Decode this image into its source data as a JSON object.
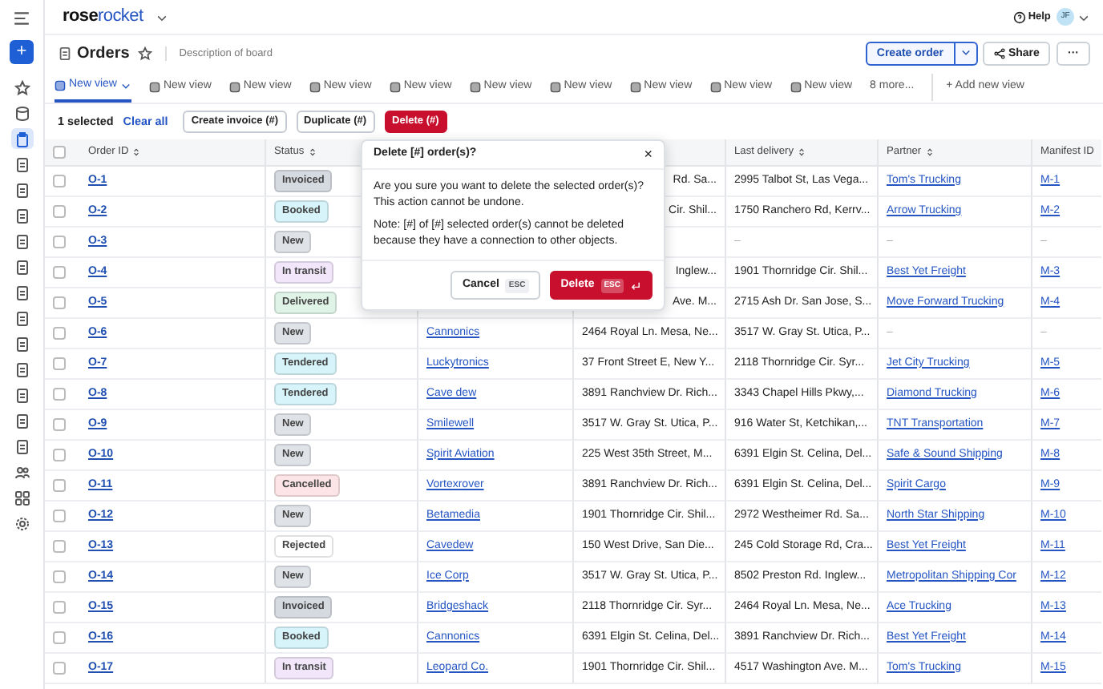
{
  "app": {
    "add": "+",
    "logo_start": "rose",
    "logo_end": "rocket",
    "help": "Help",
    "avatar": "JF"
  },
  "sidebar_items": [
    {
      "kind": "star",
      "selected": false
    },
    {
      "kind": "database",
      "selected": false
    },
    {
      "kind": "clipboard",
      "selected": true
    },
    {
      "kind": "doc",
      "selected": false
    },
    {
      "kind": "doc",
      "selected": false
    },
    {
      "kind": "doc",
      "selected": false
    },
    {
      "kind": "doc",
      "selected": false
    },
    {
      "kind": "doc",
      "selected": false
    },
    {
      "kind": "doc",
      "selected": false
    },
    {
      "kind": "doc",
      "selected": false
    },
    {
      "kind": "doc",
      "selected": false
    },
    {
      "kind": "doc",
      "selected": false
    },
    {
      "kind": "doc",
      "selected": false
    },
    {
      "kind": "doc",
      "selected": false
    },
    {
      "kind": "doc",
      "selected": false
    },
    {
      "kind": "people",
      "selected": false
    },
    {
      "kind": "grid",
      "selected": false
    },
    {
      "kind": "gear",
      "selected": false
    }
  ],
  "board": {
    "title": "Orders",
    "description": "Description of board",
    "create": "Create order",
    "share": "Share",
    "more": "···"
  },
  "tabs": [
    {
      "label": "New view",
      "selected": true
    },
    {
      "label": "New view",
      "selected": false
    },
    {
      "label": "New view",
      "selected": false
    },
    {
      "label": "New view",
      "selected": false
    },
    {
      "label": "New view",
      "selected": false
    },
    {
      "label": "New view",
      "selected": false
    },
    {
      "label": "New view",
      "selected": false
    },
    {
      "label": "New view",
      "selected": false
    },
    {
      "label": "New view",
      "selected": false
    },
    {
      "label": "New view",
      "selected": false
    }
  ],
  "tabs_more": "8 more...",
  "add_view": "+ Add new view",
  "actions": {
    "selected": "1 selected",
    "clear": "Clear all",
    "buttons": [
      {
        "label": "Create invoice (#)",
        "kind": "plain"
      },
      {
        "label": "Duplicate (#)",
        "kind": "plain"
      },
      {
        "label": "Delete (#)",
        "kind": "danger"
      }
    ]
  },
  "table": {
    "select_all_checked": false,
    "columns": [
      "Order ID",
      "Status",
      "",
      "",
      "Last delivery",
      "Partner",
      "Manifest ID"
    ],
    "rows": [
      {
        "checked": false,
        "id": "O-1",
        "status": {
          "label": "Invoiced",
          "color": "#d5d9e0"
        },
        "pickup": "Rd. Sa...",
        "delivery": "2995 Talbot St, Las Vega...",
        "partner": "Tom's Trucking",
        "manifest": "M-1"
      },
      {
        "checked": false,
        "id": "O-2",
        "status": {
          "label": "Booked",
          "color": "#d6f4fa"
        },
        "pickup": "Cir. Shil...",
        "delivery": "1750 Ranchero Rd, Kerrv...",
        "partner": "Arrow Trucking",
        "manifest": "M-2"
      },
      {
        "checked": false,
        "id": "O-3",
        "status": {
          "label": "New",
          "color": "#dfe2e7"
        },
        "delivery": "–",
        "partner": "–",
        "manifest": "–"
      },
      {
        "checked": false,
        "id": "O-4",
        "status": {
          "label": "In transit",
          "color": "#f1e6fa"
        },
        "pickup": "Inglew...",
        "delivery": "1901 Thornridge Cir. Shil...",
        "partner": "Best Yet Freight",
        "manifest": "M-3"
      },
      {
        "checked": false,
        "id": "O-5",
        "status": {
          "label": "Delivered",
          "color": "#dff3e6"
        },
        "pickup": "Ave. M...",
        "delivery": "2715 Ash Dr. San Jose, S...",
        "partner": "Move Forward Trucking",
        "manifest": "M-4"
      },
      {
        "checked": false,
        "id": "O-6",
        "status": {
          "label": "New",
          "color": "#dfe2e7"
        },
        "customer": "Cannonics",
        "pickup": "2464 Royal Ln. Mesa, Ne...",
        "delivery": "3517 W. Gray St. Utica, P...",
        "partner": "–",
        "manifest": "–"
      },
      {
        "checked": false,
        "id": "O-7",
        "status": {
          "label": "Tendered",
          "color": "#d6f4fa"
        },
        "customer": "Luckytronics",
        "pickup": "37 Front Street E, New Y...",
        "delivery": "2118 Thornridge Cir. Syr...",
        "partner": "Jet City Trucking",
        "manifest": "M-5"
      },
      {
        "checked": false,
        "id": "O-8",
        "status": {
          "label": "Tendered",
          "color": "#d6f4fa"
        },
        "customer": "Cave dew",
        "pickup": "3891 Ranchview Dr. Rich...",
        "delivery": "3343 Chapel Hills Pkwy,...",
        "partner": "Diamond Trucking",
        "manifest": "M-6"
      },
      {
        "checked": false,
        "id": "O-9",
        "status": {
          "label": "New",
          "color": "#dfe2e7"
        },
        "customer": "Smilewell",
        "pickup": "3517 W. Gray St. Utica, P...",
        "delivery": "916 Water St, Ketchikan,...",
        "partner": "TNT Transportation",
        "manifest": "M-7"
      },
      {
        "checked": false,
        "id": "O-10",
        "status": {
          "label": "New",
          "color": "#dfe2e7"
        },
        "customer": "Spirit Aviation",
        "pickup": "225 West 35th Street, M...",
        "delivery": "6391 Elgin St. Celina, Del...",
        "partner": "Safe & Sound Shipping",
        "manifest": "M-8"
      },
      {
        "checked": false,
        "id": "O-11",
        "status": {
          "label": "Cancelled",
          "color": "#fde4e6"
        },
        "customer": "Vortexrover",
        "pickup": "3891 Ranchview Dr. Rich...",
        "delivery": "6391 Elgin St. Celina, Del...",
        "partner": "Spirit Cargo",
        "manifest": "M-9"
      },
      {
        "checked": false,
        "id": "O-12",
        "status": {
          "label": "New",
          "color": "#dfe2e7"
        },
        "customer": "Betamedia",
        "pickup": "1901 Thornridge Cir. Shil...",
        "delivery": "2972 Westheimer Rd. Sa...",
        "partner": "North Star Shipping",
        "manifest": "M-10"
      },
      {
        "checked": false,
        "id": "O-13",
        "status": {
          "label": "Rejected",
          "color": "#ffffff"
        },
        "customer": "Cavedew",
        "pickup": "150 West Drive, San Die...",
        "delivery": "245 Cold Storage Rd, Cra...",
        "partner": "Best Yet Freight",
        "manifest": "M-11"
      },
      {
        "checked": false,
        "id": "O-14",
        "status": {
          "label": "New",
          "color": "#dfe2e7"
        },
        "customer": "Ice Corp",
        "pickup": "3517 W. Gray St. Utica, P...",
        "delivery": "8502 Preston Rd. Inglew...",
        "partner": "Metropolitan Shipping Cor",
        "manifest": "M-12"
      },
      {
        "checked": false,
        "id": "O-15",
        "status": {
          "label": "Invoiced",
          "color": "#d5d9e0"
        },
        "customer": "Bridgeshack",
        "pickup": "2118 Thornridge Cir. Syr...",
        "delivery": "2464 Royal Ln. Mesa, Ne...",
        "partner": "Ace Trucking",
        "manifest": "M-13"
      },
      {
        "checked": false,
        "id": "O-16",
        "status": {
          "label": "Booked",
          "color": "#d6f4fa"
        },
        "customer": "Cannonics",
        "pickup": "6391 Elgin St. Celina, Del...",
        "delivery": "3891 Ranchview Dr. Rich...",
        "partner": "Best Yet Freight",
        "manifest": "M-14"
      },
      {
        "checked": false,
        "id": "O-17",
        "status": {
          "label": "In transit",
          "color": "#f1e6fa"
        },
        "customer": "Leopard Co.",
        "pickup": "1901 Thornridge Cir. Shil...",
        "delivery": "4517 Washington Ave. M...",
        "partner": "Tom's Trucking",
        "manifest": "M-15"
      }
    ]
  },
  "dialog": {
    "title": "Delete [#] order(s)?",
    "close": "×",
    "body": "Are you sure you want to delete the selected order(s)? This action cannot be undone.",
    "note": "Note: [#] of [#] selected order(s) cannot be deleted because they have a connection to other objects.",
    "cancel": "Cancel",
    "cancel_key": "ESC",
    "confirm": "Delete",
    "confirm_key": "ESC"
  }
}
